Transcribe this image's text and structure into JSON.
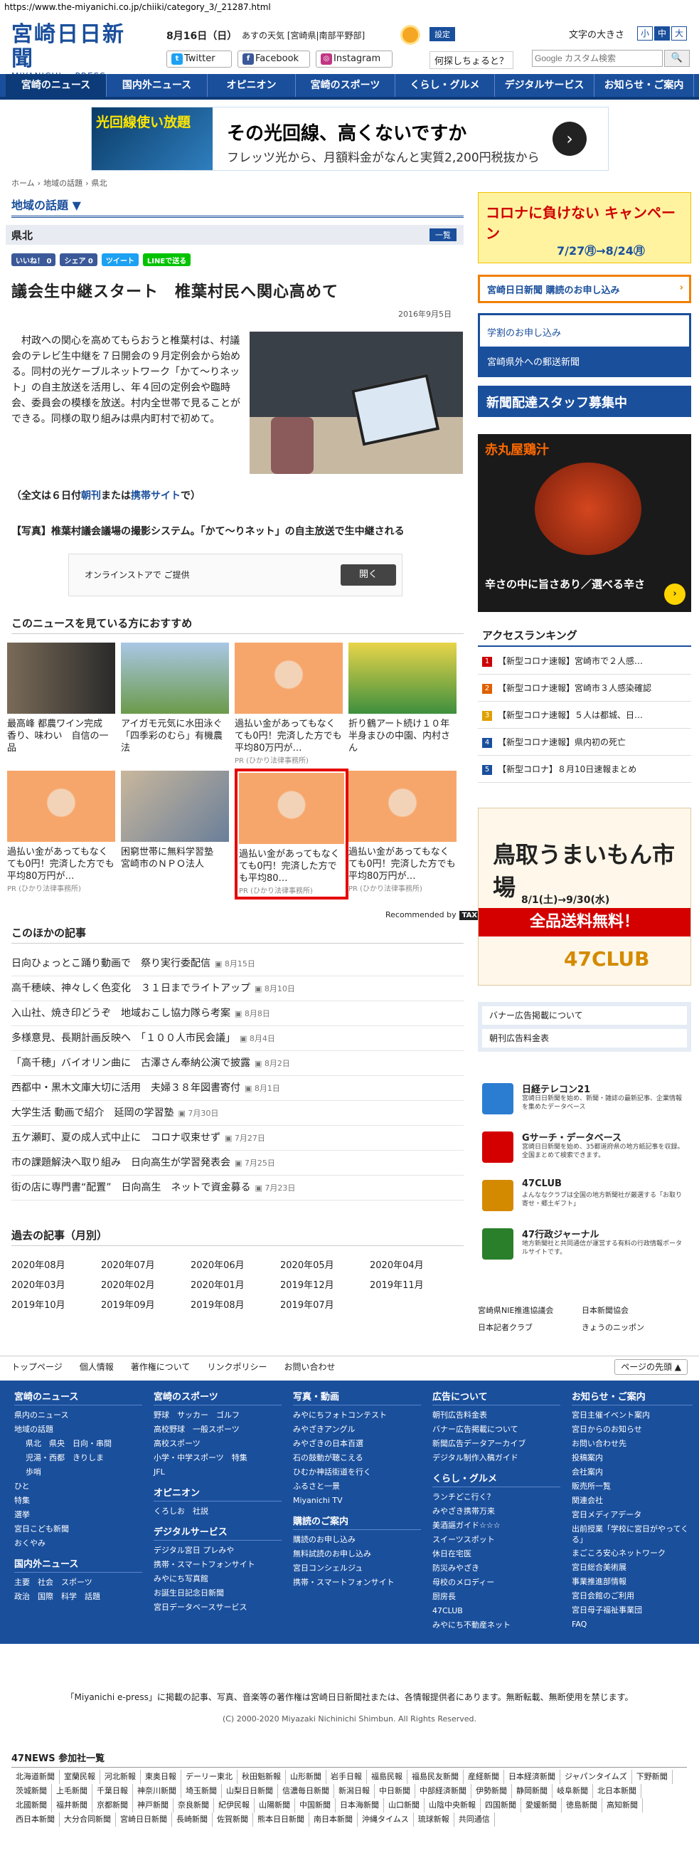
{
  "browser": {
    "url": "https://www.the-miyanichi.co.jp/chiiki/category_3/_21287.html"
  },
  "header": {
    "logo_jp": "宮崎日日新聞",
    "logo_en": "MIYANICHI e-PRESS",
    "date": "8月16日（日）",
    "weather_label": "あすの天気 [宮崎県|南部平野部]",
    "settings_label": "設定",
    "font_size_label": "文字の大きさ",
    "font_sizes": [
      "小",
      "中",
      "大"
    ],
    "twitter": "Twitter",
    "facebook": "Facebook",
    "instagram": "Instagram",
    "question_link": "何探しちょると？",
    "search_placeholder": "Google カスタム検索"
  },
  "nav": [
    "宮崎のニュース",
    "国内外ニュース",
    "オピニオン",
    "宮崎のスポーツ",
    "くらし・グルメ",
    "デジタルサービス",
    "お知らせ・ご案内"
  ],
  "top_ad": {
    "left_text": "光回線使い放題",
    "headline": "その光回線、高くないですか",
    "sub": "フレッツ光から、月額料金がなんと実質2,200円税抜から"
  },
  "breadcrumb": [
    "ホーム",
    "›",
    "地域の話題",
    "›",
    "県北"
  ],
  "section_title": "地域の話題 ▼",
  "category": "県北",
  "category_button": "一覧",
  "share": {
    "like": "いいね！ 0",
    "share": "シェア 0",
    "tweet": "ツイート",
    "line": "LINEで送る"
  },
  "article": {
    "title": "議会生中継スタート　椎葉村民へ関心高めて",
    "date": "2016年9月5日",
    "body": "村政への関心を高めてもらおうと椎葉村は、村議会のテレビ生中継を７日開会の９月定例会から始める。同村の光ケーブルネットワーク「かて～りネット」の自主放送を活用し、年４回の定例会や臨時会、委員会の模様を放送。村内全世帯で見ることができる。同様の取り組みは県内町村で初めて。",
    "full_text": [
      "（全文は６日付",
      "朝刊",
      "または",
      "携帯サイト",
      "で）"
    ],
    "caption": "【写真】椎葉村議会議場の撮影システム。「かて～りネット」の自主放送で生中継される"
  },
  "small_ad": {
    "text": "オンラインストアで ご提供",
    "button": "開く"
  },
  "recommend": {
    "title": "このニュースを見ている方におすすめ",
    "items": [
      {
        "text": "最高峰 都農ワイン完成　香り、味わい　自信の一品",
        "pr": ""
      },
      {
        "text": "アイガモ元気に水田泳ぐ「四季彩のむら」有機農法",
        "pr": ""
      },
      {
        "text": "過払い金があってもなくても0円！完済した方でも平均80万円が…",
        "pr": "PR (ひかり法律事務所)"
      },
      {
        "text": "折り鶴アート続け１０年　半身まひの中園、内村さん",
        "pr": ""
      },
      {
        "text": "過払い金があってもなくても0円！完済した方でも平均80万円が…",
        "pr": "PR (ひかり法律事務所)"
      },
      {
        "text": "困窮世帯に無料学習塾　宮崎市のＮＰＯ法人",
        "pr": ""
      },
      {
        "text": "過払い金があってもなくても0円！完済した方でも平均80…",
        "pr": "PR (ひかり法律事務所)"
      },
      {
        "text": "過払い金があってもなくても0円！完済した方でも平均80万円が…",
        "pr": "PR (ひかり法律事務所)"
      }
    ],
    "recommended_by": "Recommended by",
    "provider": "TAXEL"
  },
  "others": {
    "title": "このほかの記事",
    "items": [
      {
        "t": "日向ひょっとこ踊り動画で　祭り実行委配信",
        "d": "8月15日"
      },
      {
        "t": "高千穂峡、神々しく色変化　３１日までライトアップ",
        "d": "8月10日"
      },
      {
        "t": "入山社、焼き印どうぞ　地域おこし協力隊ら考案",
        "d": "8月8日"
      },
      {
        "t": "多様意見、長期計画反映へ　「１００人市民会議」",
        "d": "8月4日"
      },
      {
        "t": "「高千穂」バイオリン曲に　古澤さん奉納公演で披露",
        "d": "8月2日"
      },
      {
        "t": "西都中・黒木文庫大切に活用　夫婦３８年図書寄付",
        "d": "8月1日"
      },
      {
        "t": "大学生活 動画で紹介　延岡の学習塾",
        "d": "7月30日"
      },
      {
        "t": "五ケ瀬町、夏の成人式中止に　コロナ収束せず",
        "d": "7月27日"
      },
      {
        "t": "市の課題解決へ取り組み　日向高生が学習発表会",
        "d": "7月25日"
      },
      {
        "t": "街の店に専門書“配置”　日向高生　ネットで資金募る",
        "d": "7月23日"
      }
    ]
  },
  "archive": {
    "title": "過去の記事（月別）",
    "months": [
      "2020年08月",
      "2020年07月",
      "2020年06月",
      "2020年05月",
      "2020年04月",
      "2020年03月",
      "2020年02月",
      "2020年01月",
      "2019年12月",
      "2019年11月",
      "2019年10月",
      "2019年09月",
      "2019年08月",
      "2019年07月"
    ]
  },
  "sidebar": {
    "campaign": {
      "headline": "コロナに負けない キャンペーン",
      "dates": "7/27㊊→8/24㊊"
    },
    "subscribe": "宮崎日日新聞 購読のお申し込み",
    "apply": "学割のお申し込み",
    "mail": "宮崎県外への郵送新聞",
    "staff": "新聞配達スタッフ募集中",
    "food_ad": {
      "title": "赤丸屋鶏汁",
      "text": "辛さの中に旨さあり／選べる辛さ"
    },
    "ranking_title": "アクセスランキング",
    "ranking": [
      "【新型コロナ速報】宮崎市で２人感…",
      "【新型コロナ速報】宮崎市３人感染確認",
      "【新型コロナ速報】５人は都城、日…",
      "【新型コロナ速報】県内初の死亡",
      "【新型コロナ】８月10日速報まとめ"
    ],
    "tottori_ad": {
      "title": "鳥取うまいもん市場",
      "sale": "全品送料無料！",
      "dates": "8/1(土)→9/30(水)",
      "brand": "47CLUB"
    },
    "links": [
      "バナー広告掲載について",
      "朝刊広告料金表"
    ],
    "services": [
      {
        "title": "日経テレコン21",
        "desc": "宮崎日日新聞を始め、新聞・雑誌の最新記事、企業情報を集めたデータベース"
      },
      {
        "title": "Gサーチ・データベース",
        "desc": "宮崎日日新聞を始め、35都道府県の地方紙記事を収録。全国まとめて検索できます。"
      },
      {
        "title": "47CLUB",
        "desc": "よんななクラブは全国の地方新聞社が厳選する「お取り寄せ・郷土ギフト」"
      },
      {
        "title": "47行政ジャーナル",
        "desc": "地方新聞社と共同通信が運営する有料の行政情報ポータルサイトです。"
      }
    ],
    "mini_links": [
      "宮崎県NIE推進協議会",
      "日本新聞協会",
      "日本記者クラブ",
      "きょうのニッポン"
    ]
  },
  "subnav": {
    "items": [
      "トップページ",
      "個人情報",
      "著作権について",
      "リンクポリシー",
      "お問い合わせ"
    ],
    "top": "ページの先頭"
  },
  "footer": {
    "cols": [
      {
        "h": "宮崎のニュース",
        "items": [
          "県内のニュース",
          "地域の話題",
          "県北　県央　日向・串間",
          "児湯・西都　きりしま",
          "歩哨",
          "ひと",
          "特集",
          "選挙",
          "宮日こども新聞",
          "おくやみ"
        ]
      },
      {
        "h": "宮崎のスポーツ",
        "items": [
          "野球　サッカー　ゴルフ",
          "高校野球　一般スポーツ",
          "高校スポーツ",
          "小学・中学スポーツ　特集",
          "JFL"
        ]
      },
      {
        "h": "写真・動画",
        "items": [
          "みやにちフォトコンテスト",
          "みやざきアングル",
          "みやざきの日本百選",
          "石の鼓動が聴こえる",
          "ひむか神話街道を行く",
          "ふるさと一景",
          "Miyanichi TV"
        ]
      },
      {
        "h": "広告について",
        "items": [
          "朝刊広告料金表",
          "バナー広告掲載について",
          "新聞広告データアーカイブ",
          "デジタル制作入稿ガイド"
        ]
      },
      {
        "h": "お知らせ・ご案内",
        "items": [
          "宮日主催イベント案内",
          "宮日からのお知らせ",
          "お問い合わせ先",
          "投稿案内",
          "会社案内",
          "販売所一覧",
          "関連会社",
          "宮日メディアデータ",
          "出前授業「学校に宮日がやってくる」",
          "まごころ安心ネットワーク",
          "宮日総合美術展",
          "事業推進部情報",
          "宮日会館のご利用",
          "宮日母子福祉事業団",
          "FAQ"
        ]
      }
    ],
    "col_extra": [
      {
        "h": "国内外ニュース",
        "items": [
          "主要　社会　スポーツ",
          "政治　国際　科学　話題"
        ]
      },
      {
        "h": "オピニオン",
        "items": [
          "くろしお　社説"
        ]
      },
      {
        "h": "デジタルサービス",
        "items": [
          "デジタル宮日 プレみや",
          "携帯・スマートフォンサイト",
          "みやにち写真館",
          "お誕生日記念日新聞",
          "宮日データベースサービス"
        ]
      },
      {
        "h": "購読のご案内",
        "items": [
          "購読のお申し込み",
          "無料試読のお申し込み",
          "宮日コンシェルジュ",
          "携帯・スマートフォンサイト"
        ]
      },
      {
        "h": "くらし・グルメ",
        "items": [
          "ランチどこ行く？",
          "みやざき携帯万来",
          "美酒謳ガイド☆☆☆",
          "スイーツスポット",
          "休日在宅医",
          "防災みやざき",
          "母校のメロディー",
          "厨房長",
          "47CLUB",
          "みやにち不動産ネット"
        ]
      }
    ],
    "copyright_note": "「Miyanichi e-press」に掲載の記事、写真、音楽等の著作権は宮崎日日新聞社または、各情報提供者にあります。無断転載、無断使用を禁じます。",
    "copyright": "(C) 2000-2020 Miyazaki Nichinichi Shimbun. All Rights Reserved."
  },
  "news47": {
    "title": "47NEWS 参加社一覧",
    "members": [
      "北海道新聞",
      "室蘭民報",
      "河北新報",
      "東奥日報",
      "デーリー東北",
      "秋田魁新報",
      "山形新聞",
      "岩手日報",
      "福島民報",
      "福島民友新聞",
      "産経新聞",
      "日本経済新聞",
      "ジャパンタイムズ",
      "下野新聞",
      "茨城新聞",
      "上毛新聞",
      "千葉日報",
      "神奈川新聞",
      "埼玉新聞",
      "山梨日日新聞",
      "信濃毎日新聞",
      "新潟日報",
      "中日新聞",
      "中部経済新聞",
      "伊勢新聞",
      "静岡新聞",
      "岐阜新聞",
      "北日本新聞",
      "北國新聞",
      "福井新聞",
      "京都新聞",
      "神戸新聞",
      "奈良新聞",
      "紀伊民報",
      "山陽新聞",
      "中国新聞",
      "日本海新聞",
      "山口新聞",
      "山陰中央新報",
      "四国新聞",
      "愛媛新聞",
      "徳島新聞",
      "高知新聞",
      "西日本新聞",
      "大分合同新聞",
      "宮崎日日新聞",
      "長崎新聞",
      "佐賀新聞",
      "熊本日日新聞",
      "南日本新聞",
      "沖縄タイムス",
      "琉球新報",
      "共同通信"
    ]
  }
}
